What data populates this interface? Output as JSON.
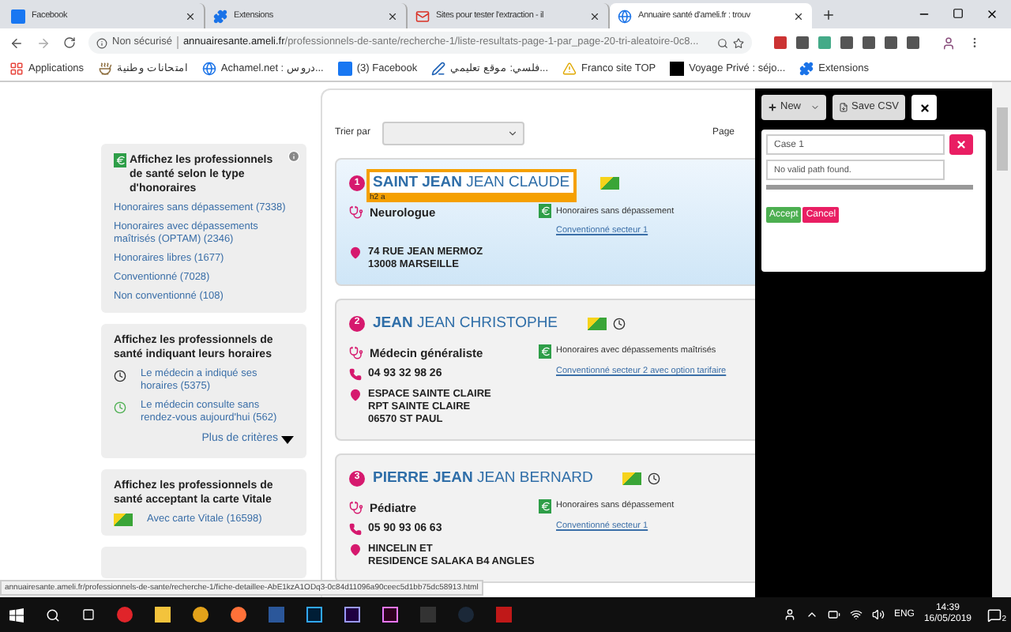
{
  "tabs": [
    {
      "title": "Facebook",
      "selected": false
    },
    {
      "title": "Extensions",
      "selected": false
    },
    {
      "title": "Sites pour tester l'extraction - il",
      "selected": false
    },
    {
      "title": "Annuaire santé d'ameli.fr : trouv",
      "selected": true
    }
  ],
  "address_bar": {
    "security": "Non sécurisé",
    "domain": "annuairesante.ameli.fr",
    "path": "/professionnels-de-sante/recherche-1/liste-resultats-page-1-par_page-20-tri-aleatoire-0c8..."
  },
  "bookmarks": [
    "Applications",
    "امتحانات وطنية",
    "Achamel.net : دروس...",
    "(3) Facebook",
    "فلسي: موقع تعليمي...",
    "Franco site TOP",
    "Voyage Privé : séjo...",
    "Extensions"
  ],
  "filters": [
    {
      "title": "Affichez les professionnels de santé selon le type d'honoraires",
      "kind": "links",
      "items": [
        {
          "label": "Honoraires sans dépassement (7338)"
        },
        {
          "label": "Honoraires avec dépassements maîtrisés (OPTAM) (2346)"
        },
        {
          "label": "Honoraires libres (1677)"
        },
        {
          "label": "Conventionné (7028)"
        },
        {
          "label": "Non conventionné (108)"
        }
      ]
    },
    {
      "title": "Affichez les professionnels de santé indiquant leurs horaires",
      "kind": "clocks",
      "items": [
        {
          "label": "Le médecin a indiqué ses horaires (5375)",
          "color": "#333333"
        },
        {
          "label": "Le médecin consulte sans rendez-vous aujourd'hui (562)",
          "color": "#4caf50"
        }
      ],
      "more": "Plus de critères"
    },
    {
      "title": "Affichez les professionnels de santé acceptant la carte Vitale",
      "kind": "vitale",
      "items": [
        {
          "label": "Avec carte Vitale (16598)"
        }
      ]
    }
  ],
  "sort": {
    "label": "Trier par",
    "page_label": "Page"
  },
  "results": [
    {
      "number": "1",
      "last_name": "SAINT JEAN",
      "first_name": "JEAN CLAUDE",
      "selected": true,
      "highlight_tag": "h2 a",
      "hours": false,
      "specialty": "Neurologue",
      "address": [
        "74 RUE JEAN MERMOZ",
        "13008 MARSEILLE"
      ],
      "fees": "Honoraires sans dépassement",
      "sector": "Conventionné secteur 1"
    },
    {
      "number": "2",
      "last_name": "JEAN",
      "first_name": "JEAN CHRISTOPHE",
      "selected": false,
      "hours": true,
      "specialty": "Médecin généraliste",
      "phone": "04 93 32 98 26",
      "address": [
        "ESPACE SAINTE CLAIRE",
        "RPT SAINTE CLAIRE",
        "06570 ST PAUL"
      ],
      "fees": "Honoraires avec dépassements maîtrisés",
      "sector": "Conventionné secteur 2 avec option tarifaire"
    },
    {
      "number": "3",
      "last_name": "PIERRE JEAN",
      "first_name": "JEAN BERNARD",
      "selected": false,
      "hours": true,
      "specialty": "Pédiatre",
      "phone": "05 90 93 06 63",
      "address": [
        "HINCELIN ET",
        "RESIDENCE SALAKA B4 ANGLES"
      ],
      "fees": "Honoraires sans dépassement",
      "sector": "Conventionné secteur 1"
    }
  ],
  "scraper": {
    "new_label": "New",
    "save_label": "Save CSV",
    "case_value": "Case 1",
    "path_value": "No valid path found.",
    "accept": "Accept",
    "cancel": "Cancel"
  },
  "status_url": "annuairesante.ameli.fr/professionnels-de-sante/recherche-1/fiche-detaillee-AbE1kzA1ODq3-0c84d11096a90ceec5d1bb75dc58913.html",
  "taskbar": {
    "language": "ENG",
    "time": "14:39",
    "date": "16/05/2019",
    "notifications": "2"
  }
}
